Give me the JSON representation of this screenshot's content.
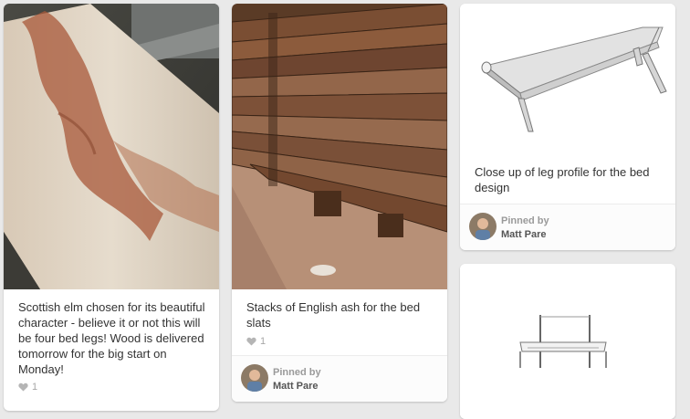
{
  "pins": [
    {
      "description": "Scottish elm chosen for its beautiful character - believe it or not this will be four bed legs! Wood is delivered tomorrow for the big start on Monday!",
      "likes": "1",
      "image_icon": "wood-slab-photo"
    },
    {
      "description": "Stacks of English ash for the bed slats",
      "likes": "1",
      "pinned_by_label": "Pinned by",
      "pinner": "Matt Pare",
      "image_icon": "wood-stack-photo"
    },
    {
      "description": "Close up of leg profile for the bed design",
      "pinned_by_label": "Pinned by",
      "pinner": "Matt Pare",
      "image_icon": "bed-leg-render"
    },
    {
      "image_icon": "bed-frame-render"
    }
  ],
  "colors": {
    "background": "#e9e9e9",
    "card": "#ffffff",
    "text": "#333333",
    "muted": "#a7a7a7"
  }
}
